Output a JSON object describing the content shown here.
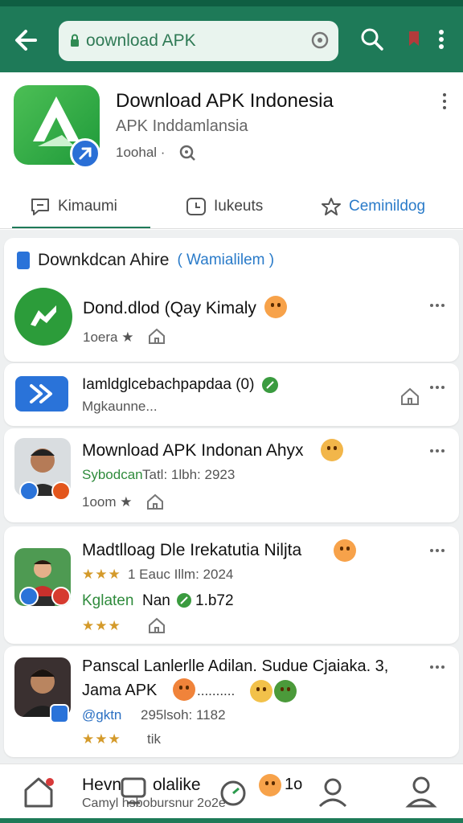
{
  "browser": {
    "url_text": "oownload APK"
  },
  "app": {
    "title": "Download APK Indonesia",
    "subtitle": "APK Inddamlansia",
    "meta": "1oohal ·"
  },
  "tabs": [
    {
      "label": "Kimaumi"
    },
    {
      "label": "Iukeuts"
    },
    {
      "label": "Ceminildog"
    }
  ],
  "section": {
    "title": "Downkdcan Ahire",
    "link": "( Wamialilem )"
  },
  "rows": [
    {
      "title": "Dond.dlod (Qay Kimaly",
      "sub": "1oera ★"
    },
    {
      "title": "Iamldglcebachpapdaa (0)",
      "sub": "Mgkaunne..."
    },
    {
      "title": "Mownload APK Indonan Ahyx",
      "green": "Sybodcan",
      "sub": "Tatl: 1lbh: 2923",
      "sub2": "1oom ★"
    },
    {
      "title": "Madtlloag Dle Irekatutia Niljta",
      "stars_text": "1 Eauc Illm: 2024",
      "green": "Kglaten",
      "sub2": "Nan",
      "green2": "1.b72",
      "stars": "★★★"
    },
    {
      "title": "Panscal Lanlerlle Adilan. Sudue Cjaiaka. 3,",
      "title2": "Jama APK",
      "title2_tail": "..........",
      "green": "@gktn",
      "sub": "295lsoh: 1182",
      "stars": "★★★",
      "stars_tail": "tik"
    }
  ],
  "bottom_nav": {
    "text1": "Hevn",
    "text1b": "olalike",
    "text2": "Camyl hsbobursnur 2o2e",
    "text3": "1o"
  },
  "colors": {
    "brand_green": "#1e7a58",
    "link_blue": "#2a7bc9",
    "accent_orange": "#f7a24a"
  }
}
